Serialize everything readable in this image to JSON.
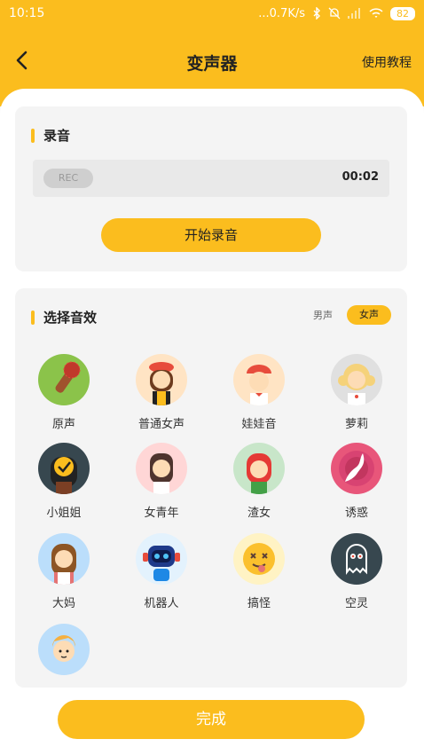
{
  "status_bar": {
    "time": "10:15",
    "network": "...0.7K/s",
    "battery": "82"
  },
  "nav": {
    "title": "变声器",
    "tutorial_label": "使用教程"
  },
  "record_card": {
    "title": "录音",
    "rec_badge": "REC",
    "time": "00:02",
    "start_button": "开始录音"
  },
  "effect_card": {
    "title": "选择音效",
    "gender": {
      "male": "男声",
      "female": "女声",
      "selected": "女声"
    },
    "items": [
      {
        "label": "原声",
        "icon": "microphone-icon",
        "color": "#8bc34a"
      },
      {
        "label": "普通女声",
        "icon": "woman-beret-icon",
        "color": "#ffe4c4"
      },
      {
        "label": "娃娃音",
        "icon": "child-cap-icon",
        "color": "#ffe4c4"
      },
      {
        "label": "萝莉",
        "icon": "loli-girl-icon",
        "color": "#e0e0e0"
      },
      {
        "label": "小姐姐",
        "icon": "check-girl-icon",
        "color": "#37474f"
      },
      {
        "label": "女青年",
        "icon": "young-woman-icon",
        "color": "#ffd6d6"
      },
      {
        "label": "渣女",
        "icon": "redhair-girl-icon",
        "color": "#c8e6c9"
      },
      {
        "label": "诱惑",
        "icon": "silhouette-icon",
        "color": "#e8567a"
      },
      {
        "label": "大妈",
        "icon": "aunt-icon",
        "color": "#bbdefb"
      },
      {
        "label": "机器人",
        "icon": "robot-icon",
        "color": "#e3f2fd"
      },
      {
        "label": "搞怪",
        "icon": "silly-face-icon",
        "color": "#fff3c4"
      },
      {
        "label": "空灵",
        "icon": "ghost-icon",
        "color": "#37474f"
      },
      {
        "label": "",
        "icon": "blond-boy-icon",
        "color": "#bbdefb"
      }
    ]
  },
  "done_button": "完成"
}
